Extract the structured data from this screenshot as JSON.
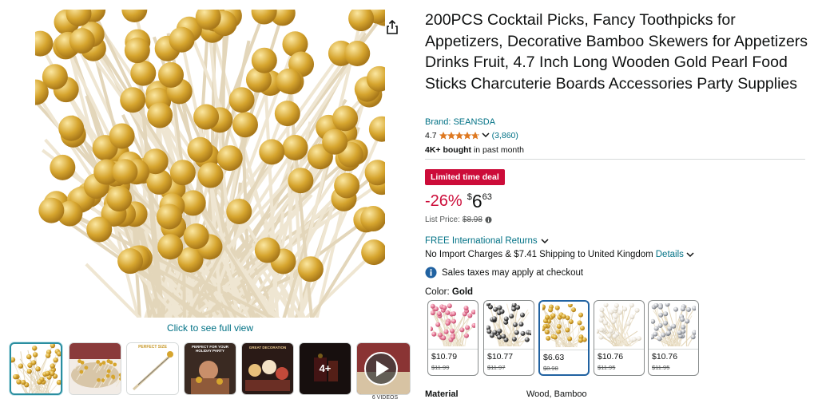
{
  "product": {
    "title": "200PCS Cocktail Picks, Fancy Toothpicks for Appetizers, Decorative Bamboo Skewers for Appetizers Drinks Fruit, 4.7 Inch Long Wooden Gold Pearl Food Sticks Charcuterie Boards Accessories Party Supplies",
    "brand": "Brand: SEANSDA",
    "rating": "4.7",
    "rating_stars": 4.7,
    "rating_count": "(3,860)",
    "bought_bold": "4K+ bought",
    "bought_rest": " in past month"
  },
  "media": {
    "click_full_view": "Click to see full view",
    "thumbnails": [
      {
        "name": "thumb-1",
        "overlay": ""
      },
      {
        "name": "thumb-2",
        "overlay": ""
      },
      {
        "name": "thumb-3",
        "overlay": "PERFECT SIZE"
      },
      {
        "name": "thumb-4",
        "overlay": "PERFECT FOR YOUR HOLIDAY PARTY"
      },
      {
        "name": "thumb-5",
        "overlay": "GREAT DECORATION"
      },
      {
        "name": "thumb-6",
        "overlay": "4+"
      },
      {
        "name": "thumb-video",
        "overlay": ""
      }
    ],
    "videos_label": "6 VIDEOS"
  },
  "deal": {
    "badge": "Limited time deal",
    "discount": "-26%",
    "currency": "$",
    "whole": "6",
    "fraction": "63",
    "list_price_label": "List Price: ",
    "list_price": "$8.98"
  },
  "shipping": {
    "returns": "FREE International Returns",
    "import_text": "No Import Charges & $7.41 Shipping to United Kingdom ",
    "details": "Details",
    "sales_tax": "Sales taxes may apply at checkout"
  },
  "color": {
    "label": "Color: ",
    "selected": "Gold",
    "options": [
      {
        "price": "$10.79",
        "old": "$11.99",
        "variant": "pink-pearl"
      },
      {
        "price": "$10.77",
        "old": "$11.97",
        "variant": "black-white"
      },
      {
        "price": "$6.63",
        "old": "$8.98",
        "variant": "gold",
        "selected": true
      },
      {
        "price": "$10.76",
        "old": "$11.95",
        "variant": "white-pearl"
      },
      {
        "price": "$10.76",
        "old": "$11.95",
        "variant": "silver"
      }
    ]
  },
  "specs": {
    "material_label": "Material",
    "material_value": "Wood, Bamboo"
  },
  "colors": {
    "link": "#007185",
    "deal_red": "#cc0c39",
    "star": "#de7921",
    "pearl_gold": "#d6a52e"
  }
}
